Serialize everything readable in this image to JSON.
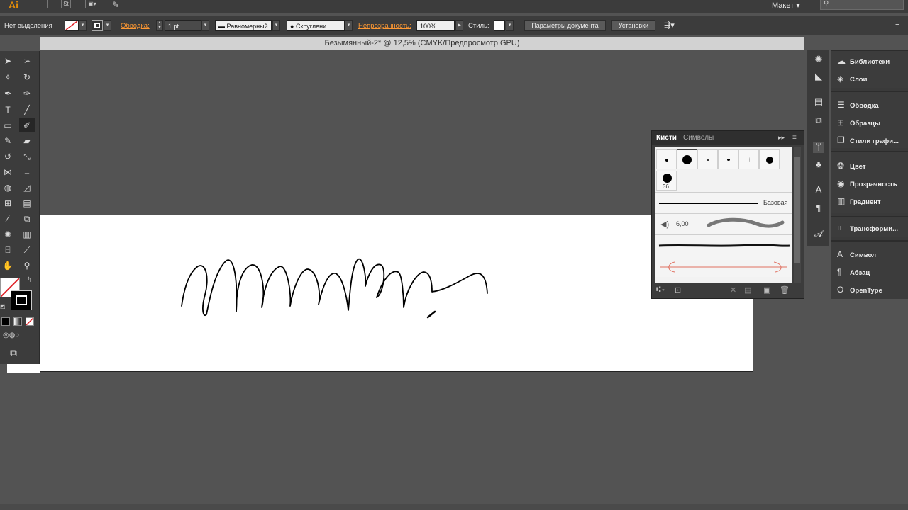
{
  "appbar": {
    "logo": "Ai",
    "bridge": "St",
    "workspace": "Макет",
    "workspace_arrow": "▾"
  },
  "control_bar": {
    "selection_status": "Нет выделения",
    "stroke_label": "Обводка:",
    "stroke_weight": "1 pt",
    "profile": "Равномерный",
    "brush": "Скруглени...",
    "opacity_label": "Непрозрачность:",
    "opacity_value": "100%",
    "style_label": "Стиль:",
    "doc_settings_button": "Параметры документа",
    "preferences_button": "Установки"
  },
  "document": {
    "tab_title": "Безымянный-2* @ 12,5% (CMYK/Предпросмотр GPU)"
  },
  "brushes_panel": {
    "tab_brushes": "Кисти",
    "tab_symbols": "Символы",
    "brush_size_label": "36",
    "basic_brush": "Базовая",
    "art_brush_size": "6,00"
  },
  "dock": {
    "items": [
      {
        "label": "Библиотеки",
        "icon": "cloud-icon"
      },
      {
        "label": "Слои",
        "icon": "layers-icon"
      },
      {
        "label": "Обводка",
        "icon": "stroke-icon"
      },
      {
        "label": "Образцы",
        "icon": "swatches-icon"
      },
      {
        "label": "Стили графи...",
        "icon": "graphic-styles-icon"
      },
      {
        "label": "Цвет",
        "icon": "color-icon"
      },
      {
        "label": "Прозрачность",
        "icon": "transparency-icon"
      },
      {
        "label": "Градиент",
        "icon": "gradient-icon"
      },
      {
        "label": "Трансформи...",
        "icon": "transform-icon"
      },
      {
        "label": "Символ",
        "icon": "character-icon"
      },
      {
        "label": "Абзац",
        "icon": "paragraph-icon"
      },
      {
        "label": "OpenType",
        "icon": "opentype-icon"
      }
    ]
  },
  "colors": {
    "orange_label": "#ff9933",
    "panel_bg": "#3c3c3c",
    "canvas_bg": "#535353"
  }
}
